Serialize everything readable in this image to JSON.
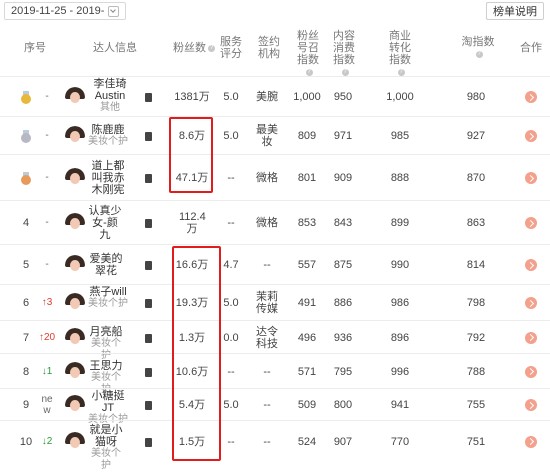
{
  "toolbar": {
    "date_range": "2019-11-25 - 2019-",
    "rank_explain_label": "榜单说明"
  },
  "columns": {
    "rank": "序号",
    "talent": "达人信息",
    "fans": "粉丝数",
    "service_score": "服务评分",
    "agency": "签约机构",
    "fans_index": "粉丝号召指数",
    "content_index": "内容消费指数",
    "commerce_index": "商业转化指数",
    "tao_index": "淘指数",
    "coop": "合作"
  },
  "rows": [
    {
      "rank": "",
      "medal": "gold",
      "trend": "-",
      "trend_type": "flat",
      "name": "李佳琦Austin",
      "sub": "其他",
      "fans": "1381万",
      "score": "5.0",
      "agency": "美腕",
      "fans_index": "1,000",
      "content_index": "950",
      "commerce_index": "1,000",
      "tao_index": "980"
    },
    {
      "rank": "",
      "medal": "silver",
      "trend": "-",
      "trend_type": "flat",
      "name": "陈鹿鹿",
      "sub": "美妆个护",
      "fans": "8.6万",
      "score": "5.0",
      "agency": "最美妆",
      "fans_index": "809",
      "content_index": "971",
      "commerce_index": "985",
      "tao_index": "927"
    },
    {
      "rank": "",
      "medal": "bronze",
      "trend": "-",
      "trend_type": "flat",
      "name": "道上都叫我赤木刚宪",
      "sub": "",
      "fans": "47.1万",
      "score": "--",
      "agency": "微格",
      "fans_index": "801",
      "content_index": "909",
      "commerce_index": "888",
      "tao_index": "870"
    },
    {
      "rank": "4",
      "medal": "",
      "trend": "-",
      "trend_type": "flat",
      "name": "认真少女-颜九",
      "sub": "",
      "fans": "112.4万",
      "score": "--",
      "agency": "微格",
      "fans_index": "853",
      "content_index": "843",
      "commerce_index": "899",
      "tao_index": "863"
    },
    {
      "rank": "5",
      "medal": "",
      "trend": "-",
      "trend_type": "flat",
      "name": "爱美的翠花",
      "sub": "",
      "fans": "16.6万",
      "score": "4.7",
      "agency": "--",
      "fans_index": "557",
      "content_index": "875",
      "commerce_index": "990",
      "tao_index": "814"
    },
    {
      "rank": "6",
      "medal": "",
      "trend": "↑3",
      "trend_type": "up",
      "name": "燕子will",
      "sub": "美妆个护",
      "fans": "19.3万",
      "score": "5.0",
      "agency": "茉莉传媒",
      "fans_index": "491",
      "content_index": "886",
      "commerce_index": "986",
      "tao_index": "798"
    },
    {
      "rank": "7",
      "medal": "",
      "trend": "↑20",
      "trend_type": "up",
      "name": "月亮船",
      "sub": "美妆个护",
      "fans": "1.3万",
      "score": "0.0",
      "agency": "达令科技",
      "fans_index": "496",
      "content_index": "936",
      "commerce_index": "896",
      "tao_index": "792"
    },
    {
      "rank": "8",
      "medal": "",
      "trend": "↓1",
      "trend_type": "down",
      "name": "王思力",
      "sub": "美妆个护",
      "fans": "10.6万",
      "score": "--",
      "agency": "--",
      "fans_index": "571",
      "content_index": "795",
      "commerce_index": "996",
      "tao_index": "788"
    },
    {
      "rank": "9",
      "medal": "",
      "trend": "ne w",
      "trend_type": "new",
      "name": "小糖挺JT",
      "sub": "美妆个护",
      "fans": "5.4万",
      "score": "5.0",
      "agency": "--",
      "fans_index": "509",
      "content_index": "800",
      "commerce_index": "941",
      "tao_index": "755"
    },
    {
      "rank": "10",
      "medal": "",
      "trend": "↓2",
      "trend_type": "down",
      "name": "就是小猫呀",
      "sub": "美妆个护",
      "fans": "1.5万",
      "score": "--",
      "agency": "--",
      "fans_index": "524",
      "content_index": "907",
      "commerce_index": "770",
      "tao_index": "751"
    }
  ],
  "colors": {
    "highlight_border": "#e11c1c",
    "trend_up": "#e03a2f",
    "trend_down": "#2a9a3a",
    "coop_button": "#f3a08d"
  }
}
